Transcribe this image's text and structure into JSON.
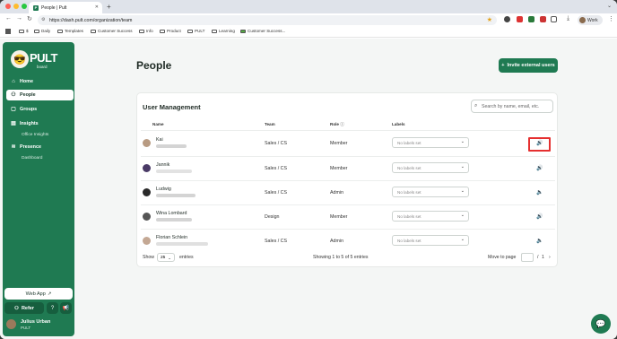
{
  "browser": {
    "tab_title": "People | Pult",
    "url": "https://dash.pult.com/organization/team",
    "profile": "Work",
    "bookmarks": [
      "Daily",
      "Templates",
      "Customer Success",
      "Info",
      "Product",
      "PULT",
      "Learning",
      "Customer Success..."
    ]
  },
  "sidebar": {
    "brand": "PULT",
    "brand_sub": "board",
    "nav": [
      {
        "label": "Home"
      },
      {
        "label": "People"
      },
      {
        "label": "Groups"
      },
      {
        "label": "Insights"
      },
      {
        "label": "Office Insights"
      },
      {
        "label": "Presence"
      },
      {
        "label": "Dashboard"
      }
    ],
    "web_app": "Web App",
    "refer": "Refer",
    "user": {
      "name": "Julius Urban",
      "org": "PULT"
    }
  },
  "page": {
    "title": "People",
    "invite_button": "Invite external users"
  },
  "table": {
    "title": "User Management",
    "search_placeholder": "Search by name, email, etc.",
    "columns": [
      "Name",
      "Team",
      "Role",
      "Labels"
    ],
    "label_placeholder": "No labels set",
    "rows": [
      {
        "name": "Kai",
        "team": "Sales / CS",
        "role": "Member"
      },
      {
        "name": "Jannik",
        "team": "Sales / CS",
        "role": "Member"
      },
      {
        "name": "Ludwig",
        "team": "Sales / CS",
        "role": "Admin"
      },
      {
        "name": "Wina Lombard",
        "team": "Design",
        "role": "Member"
      },
      {
        "name": "Florian Schlein",
        "team": "Sales / CS",
        "role": "Admin"
      }
    ],
    "footer": {
      "show": "Show",
      "page_size": "25",
      "entries": "entries",
      "summary": "Showing 1 to 5 of 5 entries",
      "move_to_page": "Move to page",
      "page_total": "1"
    }
  }
}
